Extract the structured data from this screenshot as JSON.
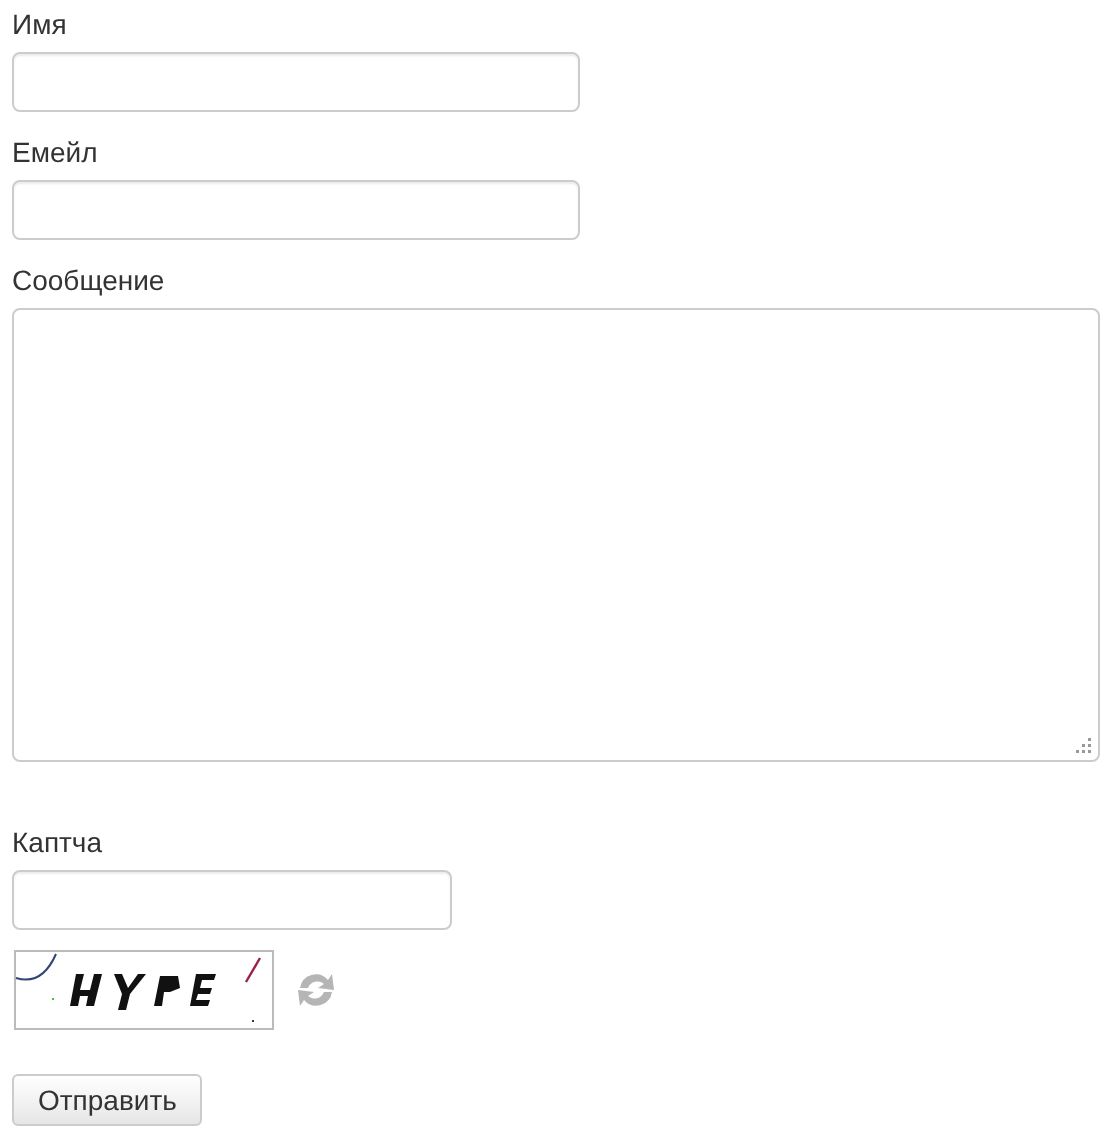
{
  "fields": [
    {
      "kind": "text",
      "label": "Имя"
    },
    {
      "kind": "text",
      "label": "Емейл"
    },
    {
      "kind": "textarea",
      "label": "Сообщение"
    }
  ],
  "captcha": {
    "label": "Каптча"
  },
  "submit": "Отправить"
}
